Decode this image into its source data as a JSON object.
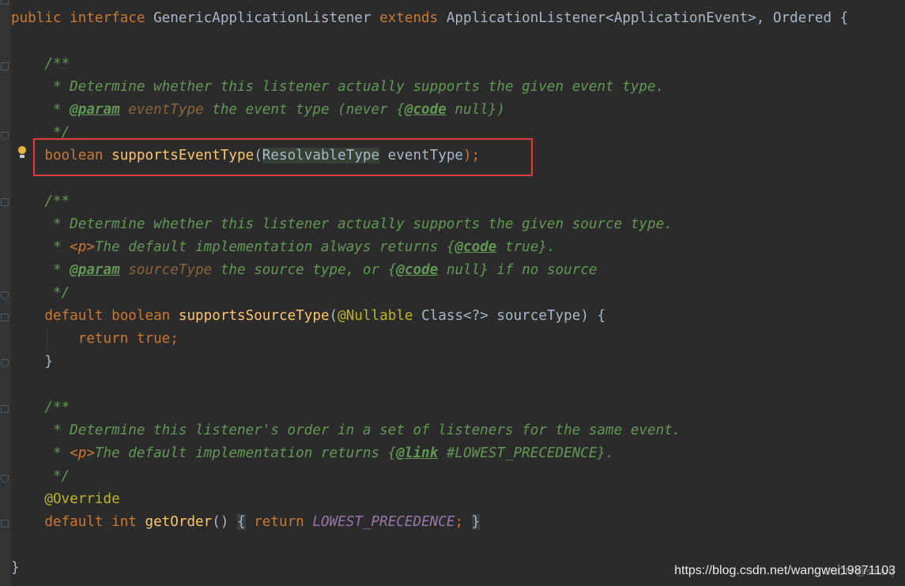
{
  "editor": {
    "theme": "darcula",
    "colors": {
      "background": "#2b2b2b",
      "keyword": "#cc7832",
      "method": "#ffc66d",
      "comment": "#629755",
      "annotation": "#bbb529",
      "constant": "#9876aa",
      "highlight_box": "#e03c3c"
    }
  },
  "code": {
    "l1": {
      "kw1": "public",
      "kw2": "interface",
      "name": "GenericApplicationListener",
      "kw3": "extends",
      "parent": "ApplicationListener<ApplicationEvent>, Ordered {"
    },
    "doc1": {
      "open": "/**",
      "line1": " * Determine whether this listener actually supports the given event type.",
      "star": " * ",
      "param_tag": "@param",
      "param_name": "eventType",
      "param_text1": " the event type (never {",
      "code_tag": "@code",
      "param_text2": " null})",
      "close": " */"
    },
    "m1": {
      "kw": "boolean",
      "name": "supportsEventType",
      "paren_open": "(",
      "type": "ResolvableType",
      "arg": " eventType",
      "end": ");"
    },
    "doc2": {
      "open": "/**",
      "line1": " * Determine whether this listener actually supports the given source type.",
      "star": " * ",
      "p_tag": "<p>",
      "line2": "The default implementation always returns {",
      "code_tag": "@code",
      "line2_end": " true}.",
      "param_tag": "@param",
      "param_name": "sourceType",
      "param_text1": " the source type, or {",
      "param_text2": " null} if no source",
      "close": " */"
    },
    "m2": {
      "kw1": "default",
      "kw2": "boolean",
      "name": "supportsSourceType",
      "paren_open": "(",
      "ann": "@Nullable",
      "arg": " Class<?> sourceType) {"
    },
    "m2_body": {
      "kw1": "return",
      "kw2": "true",
      "semi": ";"
    },
    "m2_close": "}",
    "doc3": {
      "open": "/**",
      "line1": " * Determine this listener's order in a set of listeners for the same event.",
      "star": " * ",
      "p_tag": "<p>",
      "line2": "The default implementation returns {",
      "link_tag": "@link",
      "line2_end": " #LOWEST_PRECEDENCE}.",
      "close": " */"
    },
    "override": "@Override",
    "m3": {
      "kw1": "default",
      "kw2": "int",
      "name": "getOrder",
      "parens": "()",
      "brace_open": "{",
      "ret": "return",
      "const": "LOWEST_PRECEDENCE",
      "semi": ";",
      "brace_close": "}"
    },
    "last": "}"
  },
  "watermark": {
    "url": "https://blog.csdn.net/wangwei19871103",
    "faint": "CSDN @smartj"
  },
  "icons": {
    "intention": "lightbulb-icon",
    "fold": "fold-marker-icon"
  }
}
